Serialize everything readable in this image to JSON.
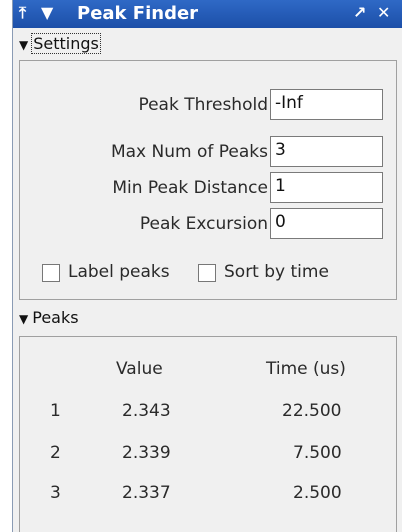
{
  "window": {
    "title": "Peak Finder",
    "left_controls": "⤒ ▼",
    "right_controls": "↗ ✕"
  },
  "settings": {
    "header": "Settings",
    "fields": [
      {
        "label": "Peak Threshold",
        "value": "-Inf"
      },
      {
        "label": "Max Num of Peaks",
        "value": "3"
      },
      {
        "label": "Min Peak Distance",
        "value": "1"
      },
      {
        "label": "Peak Excursion",
        "value": "0"
      }
    ],
    "label_peaks": {
      "label": "Label peaks",
      "checked": false
    },
    "sort_by_time": {
      "label": "Sort by time",
      "checked": false
    }
  },
  "peaks": {
    "header": "Peaks",
    "columns": [
      "Value",
      "Time (us)"
    ],
    "rows": [
      {
        "index": "1",
        "value": "2.343",
        "time": "22.500"
      },
      {
        "index": "2",
        "value": "2.339",
        "time": "7.500"
      },
      {
        "index": "3",
        "value": "2.337",
        "time": "2.500"
      }
    ]
  }
}
